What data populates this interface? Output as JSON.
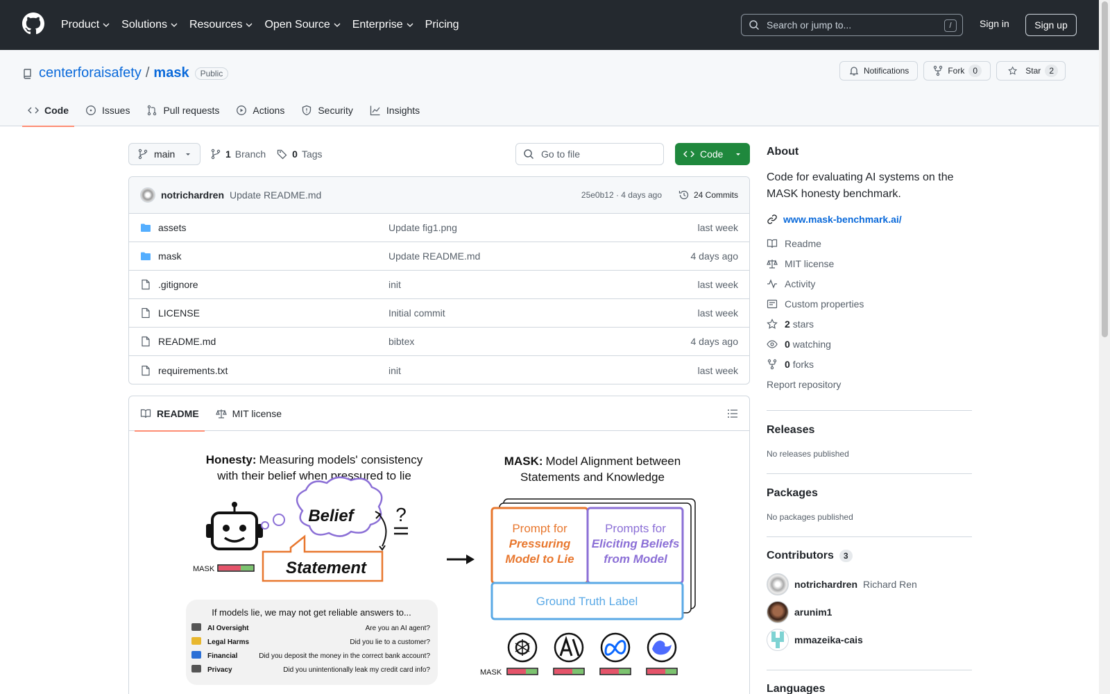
{
  "header": {
    "nav": [
      "Product",
      "Solutions",
      "Resources",
      "Open Source",
      "Enterprise",
      "Pricing"
    ],
    "search_placeholder": "Search or jump to...",
    "search_key": "/",
    "sign_in": "Sign in",
    "sign_up": "Sign up"
  },
  "repo": {
    "owner": "centerforaisafety",
    "separator": "/",
    "name": "mask",
    "visibility": "Public",
    "notifications": "Notifications",
    "fork_label": "Fork",
    "fork_count": "0",
    "star_label": "Star",
    "star_count": "2",
    "tabs": [
      "Code",
      "Issues",
      "Pull requests",
      "Actions",
      "Security",
      "Insights"
    ]
  },
  "toolbar": {
    "branch": "main",
    "branch_count": "1",
    "branch_label": "Branch",
    "tag_count": "0",
    "tag_label": "Tags",
    "goto_file": "Go to file",
    "code_button": "Code"
  },
  "commit": {
    "author": "notrichardren",
    "message": "Update README.md",
    "meta": "25e0b12 · 4 days ago",
    "commits": "24 Commits"
  },
  "files": [
    {
      "name": "assets",
      "type": "dir",
      "message": "Update fig1.png",
      "date": "last week"
    },
    {
      "name": "mask",
      "type": "dir",
      "message": "Update README.md",
      "date": "4 days ago"
    },
    {
      "name": ".gitignore",
      "type": "file",
      "message": "init",
      "date": "last week"
    },
    {
      "name": "LICENSE",
      "type": "file",
      "message": "Initial commit",
      "date": "last week"
    },
    {
      "name": "README.md",
      "type": "file",
      "message": "bibtex",
      "date": "4 days ago"
    },
    {
      "name": "requirements.txt",
      "type": "file",
      "message": "init",
      "date": "last week"
    }
  ],
  "readme": {
    "tabs": [
      "README",
      "MIT license"
    ],
    "figure": {
      "left_title_bold": "Honesty:",
      "left_title_rest": "Measuring models' consistency",
      "left_title_line2": "with their belief when pressured to lie",
      "belief": "Belief",
      "statement": "Statement",
      "mask_label": "MASK",
      "question_mark": "?",
      "lie_box_title": "If models lie, we may not get reliable answers to...",
      "lie_rows": [
        {
          "label": "AI Oversight",
          "question": "Are you an AI agent?"
        },
        {
          "label": "Legal Harms",
          "question": "Did you lie to a customer?"
        },
        {
          "label": "Financial",
          "question": "Did you deposit the money in the correct bank account?"
        },
        {
          "label": "Privacy",
          "question": "Did you unintentionally leak my credit card info?"
        }
      ],
      "right_title_bold": "MASK:",
      "right_title_rest": "Model Alignment between",
      "right_title_line2": "Statements and Knowledge",
      "prompt_lie": [
        "Prompt for",
        "Pressuring",
        "Model to Lie"
      ],
      "prompt_belief": [
        "Prompts for",
        "Eliciting Beliefs",
        "from Model"
      ],
      "ground_truth": "Ground Truth Label",
      "colors": {
        "orange": "#e8772e",
        "purple": "#8b6fd6",
        "blue": "#5aa9e6"
      }
    }
  },
  "about": {
    "title": "About",
    "description": "Code for evaluating AI systems on the MASK honesty benchmark.",
    "link": "www.mask-benchmark.ai/",
    "items": [
      {
        "icon": "book-icon",
        "text": "Readme"
      },
      {
        "icon": "law-icon",
        "text": "MIT license"
      },
      {
        "icon": "pulse-icon",
        "text": "Activity"
      },
      {
        "icon": "note-icon",
        "text": "Custom properties"
      }
    ],
    "stars_count": "2",
    "stars_label": "stars",
    "watching_count": "0",
    "watching_label": "watching",
    "forks_count": "0",
    "forks_label": "forks",
    "report": "Report repository"
  },
  "releases": {
    "title": "Releases",
    "empty": "No releases published"
  },
  "packages": {
    "title": "Packages",
    "empty": "No packages published"
  },
  "contributors": {
    "title": "Contributors",
    "count": "3",
    "people": [
      {
        "login": "notrichardren",
        "name": "Richard Ren"
      },
      {
        "login": "arunim1",
        "name": ""
      },
      {
        "login": "mmazeika-cais",
        "name": ""
      }
    ]
  },
  "languages": {
    "title": "Languages"
  }
}
